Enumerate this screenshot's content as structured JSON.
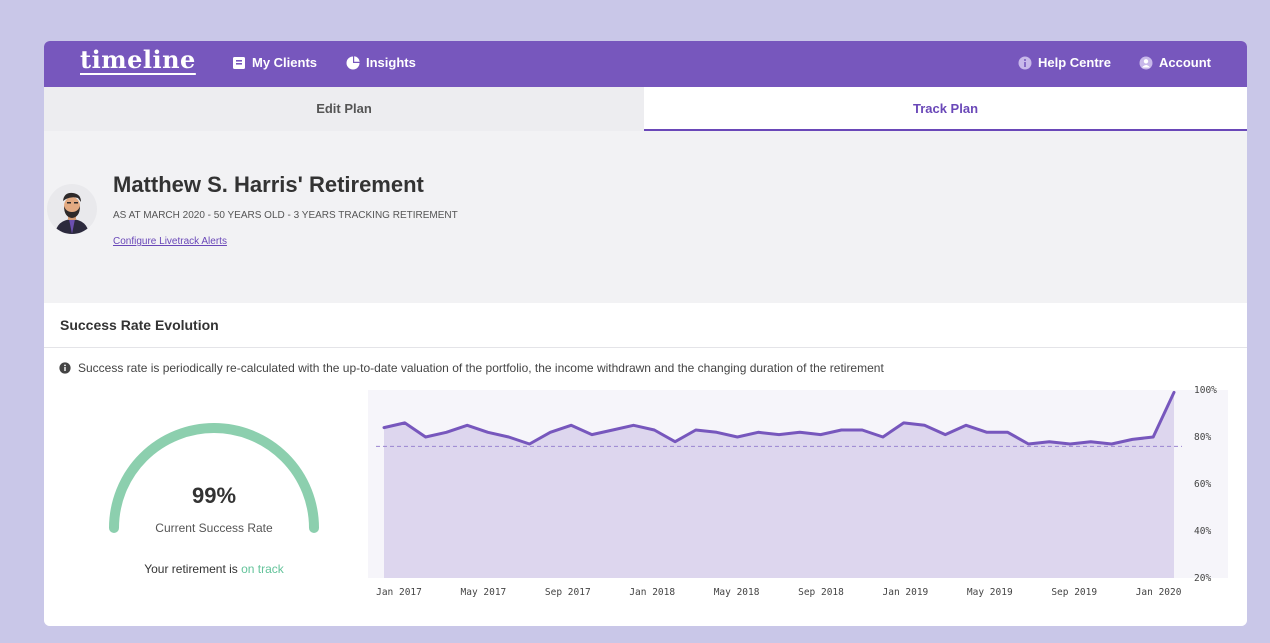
{
  "brand": "timeline",
  "nav": {
    "my_clients": "My Clients",
    "insights": "Insights",
    "help_centre": "Help Centre",
    "account": "Account"
  },
  "tabs": {
    "edit_plan": "Edit Plan",
    "track_plan": "Track Plan",
    "active": "Track Plan"
  },
  "client": {
    "title": "Matthew S. Harris' Retirement",
    "subtitle": "AS AT MARCH 2020 - 50 YEARS OLD - 3 YEARS TRACKING RETIREMENT",
    "config_link": "Configure Livetrack Alerts"
  },
  "panel": {
    "title": "Success Rate Evolution",
    "info": "Success rate is periodically re-calculated with the up-to-date valuation of the portfolio, the income withdrawn and the changing duration of the retirement"
  },
  "gauge": {
    "value": "99%",
    "fraction": 0.99,
    "label": "Current Success Rate",
    "status_prefix": "Your retirement is ",
    "status_highlight": "on track"
  },
  "colors": {
    "brand": "#7757bd",
    "accent": "#6a48b8",
    "success": "#63c39a",
    "gauge": "#8ccfae",
    "area": "#ddd6ee",
    "line": "#7757bd"
  },
  "chart_data": {
    "type": "area",
    "x_tick_labels": [
      "Jan 2017",
      "May 2017",
      "Sep 2017",
      "Jan 2018",
      "May 2018",
      "Sep 2018",
      "Jan 2019",
      "May 2019",
      "Sep 2019",
      "Jan 2020"
    ],
    "y_tick_labels": [
      "100%",
      "80%",
      "60%",
      "40%",
      "20%"
    ],
    "ylim": [
      20,
      100
    ],
    "threshold": 76,
    "x": [
      "Jan 2017",
      "Feb 2017",
      "Mar 2017",
      "Apr 2017",
      "May 2017",
      "Jun 2017",
      "Jul 2017",
      "Aug 2017",
      "Sep 2017",
      "Oct 2017",
      "Nov 2017",
      "Dec 2017",
      "Jan 2018",
      "Feb 2018",
      "Mar 2018",
      "Apr 2018",
      "May 2018",
      "Jun 2018",
      "Jul 2018",
      "Aug 2018",
      "Sep 2018",
      "Oct 2018",
      "Nov 2018",
      "Dec 2018",
      "Jan 2019",
      "Feb 2019",
      "Mar 2019",
      "Apr 2019",
      "May 2019",
      "Jun 2019",
      "Jul 2019",
      "Aug 2019",
      "Sep 2019",
      "Oct 2019",
      "Nov 2019",
      "Dec 2019",
      "Jan 2020",
      "Feb 2020",
      "Mar 2020"
    ],
    "values": [
      84,
      86,
      80,
      82,
      85,
      82,
      80,
      77,
      82,
      85,
      81,
      83,
      85,
      83,
      78,
      83,
      82,
      80,
      82,
      81,
      82,
      81,
      83,
      83,
      80,
      86,
      85,
      81,
      85,
      82,
      82,
      77,
      78,
      77,
      78,
      77,
      79,
      80,
      99
    ]
  }
}
